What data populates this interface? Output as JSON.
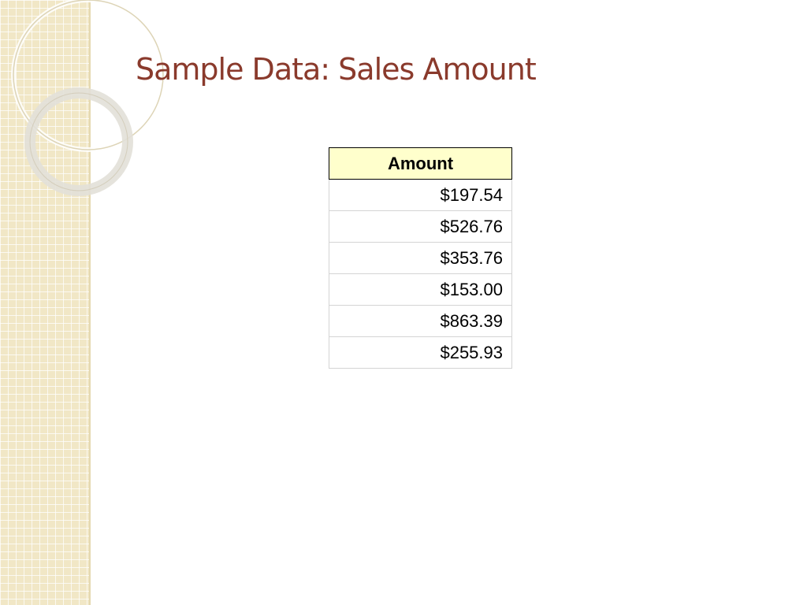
{
  "slide": {
    "title": "Sample Data: Sales Amount"
  },
  "table": {
    "header": "Amount",
    "rows": [
      "$197.54",
      "$526.76",
      "$353.76",
      "$153.00",
      "$863.39",
      "$255.93"
    ]
  },
  "colors": {
    "title": "#8a3a2c",
    "header_fill": "#ffffcc",
    "side_panel": "#f1e7c6"
  }
}
